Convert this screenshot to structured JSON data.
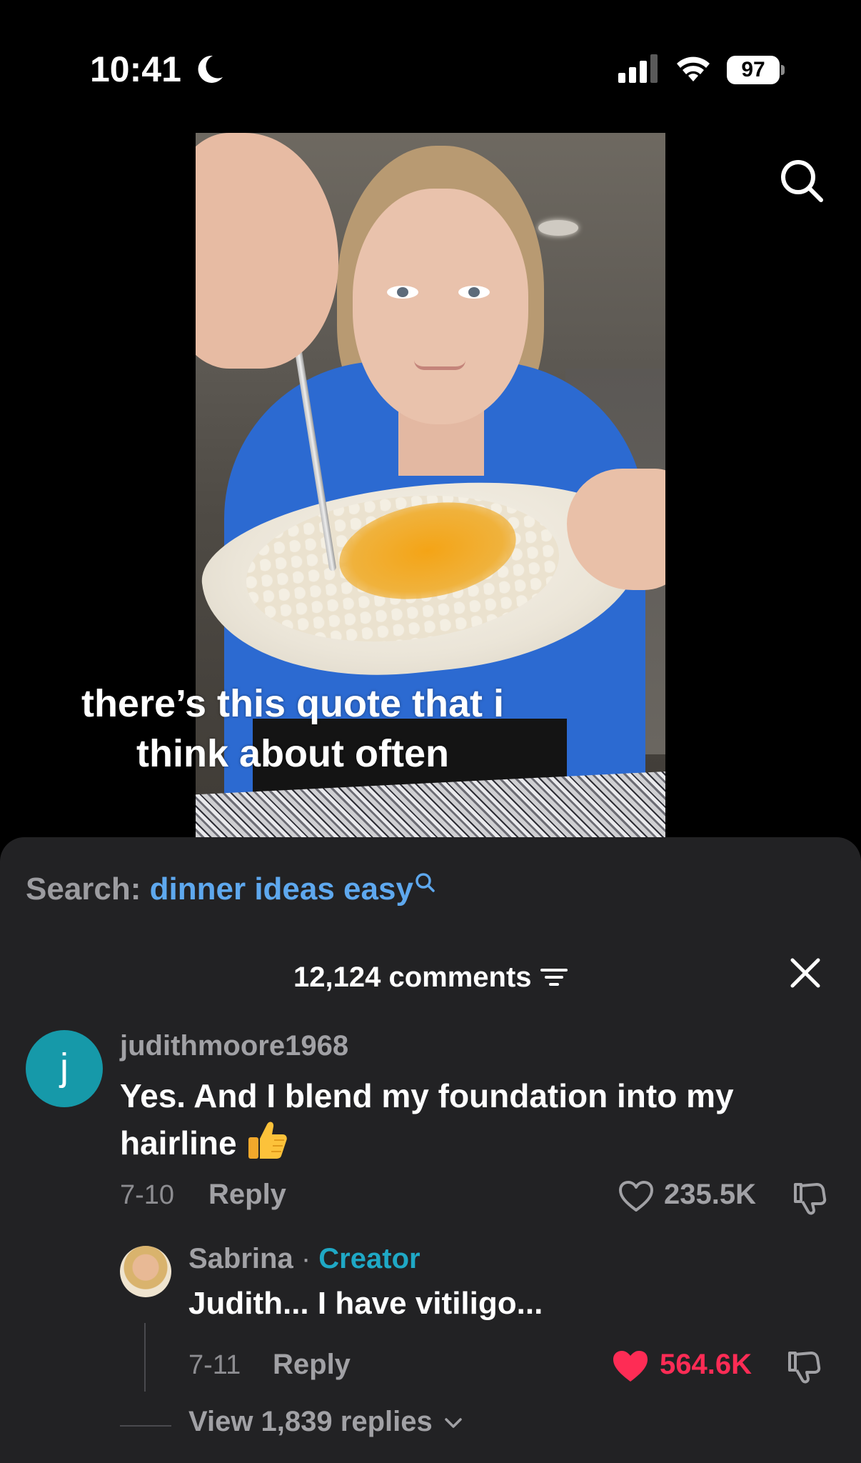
{
  "status_bar": {
    "time": "10:41",
    "battery": "97"
  },
  "video": {
    "caption_line1": "there’s this quote that i",
    "caption_line2": "think about often"
  },
  "comments": {
    "search_label": "Search: ",
    "search_query": "dinner ideas easy",
    "count_label": "12,124 comments",
    "items": [
      {
        "avatar_letter": "j",
        "username": "judithmoore1968",
        "text": "Yes. And I blend my foundation into my hairline",
        "date": "7-10",
        "reply_label": "Reply",
        "likes": "235.5K",
        "liked": false,
        "replies": [
          {
            "username": "Sabrina",
            "separator": "·",
            "badge": "Creator",
            "text": "Judith... I have vitiligo...",
            "date": "7-11",
            "reply_label": "Reply",
            "likes": "564.6K",
            "liked": true
          }
        ],
        "view_replies_label": "View 1,839 replies"
      }
    ]
  },
  "colors": {
    "accent_link": "#5ea8ee",
    "creator_badge": "#1fa8c5",
    "like_active": "#fe2c55",
    "avatar_j": "#1699a9",
    "sheet_bg": "#222224"
  },
  "icons": [
    "moon-icon",
    "signal-icon",
    "wifi-icon",
    "battery-icon",
    "search-icon",
    "sort-icon",
    "close-icon",
    "heart-icon",
    "dislike-icon",
    "thumbs-up-icon",
    "chevron-down-icon"
  ]
}
